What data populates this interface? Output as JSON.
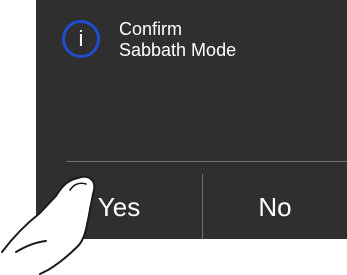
{
  "dialog": {
    "icon": "info-icon",
    "icon_glyph": "i",
    "message_line1": "Confirm",
    "message_line2": "Sabbath Mode",
    "yes_label": "Yes",
    "no_label": "No"
  },
  "colors": {
    "screen_background": "#2f2f2f",
    "icon_ring": "#1e4dcf",
    "text": "#ffffff",
    "divider": "#707070"
  }
}
